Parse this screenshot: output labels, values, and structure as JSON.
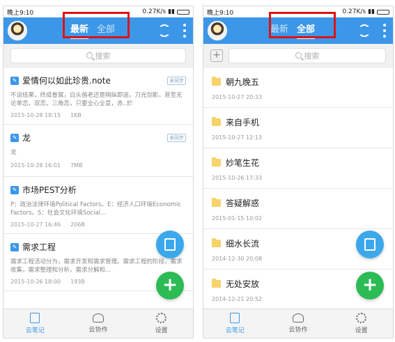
{
  "left": {
    "status": {
      "time": "晚上9:10",
      "speed": "0.27K/s"
    },
    "tabs": [
      {
        "label": "最新",
        "active": true
      },
      {
        "label": "全部",
        "active": false
      }
    ],
    "search": {
      "placeholder": "搜索"
    },
    "notes": [
      {
        "title": "爱情何以如此珍贵.note",
        "badge": "未同步",
        "snippet": "不谈结果，终成眷属，白头偕老还是稍纵即逝，刀光剑影，甚至无论单恋，双恋，三角恋，只要全心全意，赤..於",
        "date": "2015-10-28 18:15",
        "size": "1KB"
      },
      {
        "title": "龙",
        "badge": "未同步",
        "snippet": "龙",
        "date": "2015-10-28 16:01",
        "size": "7MB"
      },
      {
        "title": "市场PEST分析",
        "badge": "",
        "snippet": "P：政治法律环境Political Factors。E：经济人口环境Economic Factors。S：社会文化环境Social...",
        "date": "2015-10-27 16:46",
        "size": "206B"
      },
      {
        "title": "需求工程",
        "badge": "",
        "snippet": "需求工程活动分为，需求开发和需求管理。需求工程的阶段，需求收集，需求整理和分析，需求分解和...",
        "date": "2015-10-26 18:00",
        "size": "193B"
      }
    ],
    "nav": [
      {
        "label": "云笔记",
        "active": true
      },
      {
        "label": "云协作",
        "active": false
      },
      {
        "label": "设置",
        "active": false
      }
    ]
  },
  "right": {
    "status": {
      "time": "晚上9:10",
      "speed": "0.27K/s"
    },
    "tabs": [
      {
        "label": "最新",
        "active": false
      },
      {
        "label": "全部",
        "active": true
      }
    ],
    "search": {
      "placeholder": "搜索"
    },
    "folders": [
      {
        "name": "朝九晚五",
        "date": "2015-10-27 20:33"
      },
      {
        "name": "来自手机",
        "date": "2015-10-27 12:13"
      },
      {
        "name": "妙笔生花",
        "date": "2015-10-26 17:33"
      },
      {
        "name": "答疑解惑",
        "date": "2015-01-15 10:02"
      },
      {
        "name": "细水长流",
        "date": "2014-12-30 20:08"
      },
      {
        "name": "无处安放",
        "date": "2014-12-21 20:52"
      }
    ],
    "nav": [
      {
        "label": "云笔记",
        "active": true
      },
      {
        "label": "云协作",
        "active": false
      },
      {
        "label": "设置",
        "active": false
      }
    ]
  },
  "colors": {
    "primary": "#3c97e8",
    "highlight": "#e01212",
    "fab_green": "#2dbb55",
    "folder": "#f6d36b"
  }
}
